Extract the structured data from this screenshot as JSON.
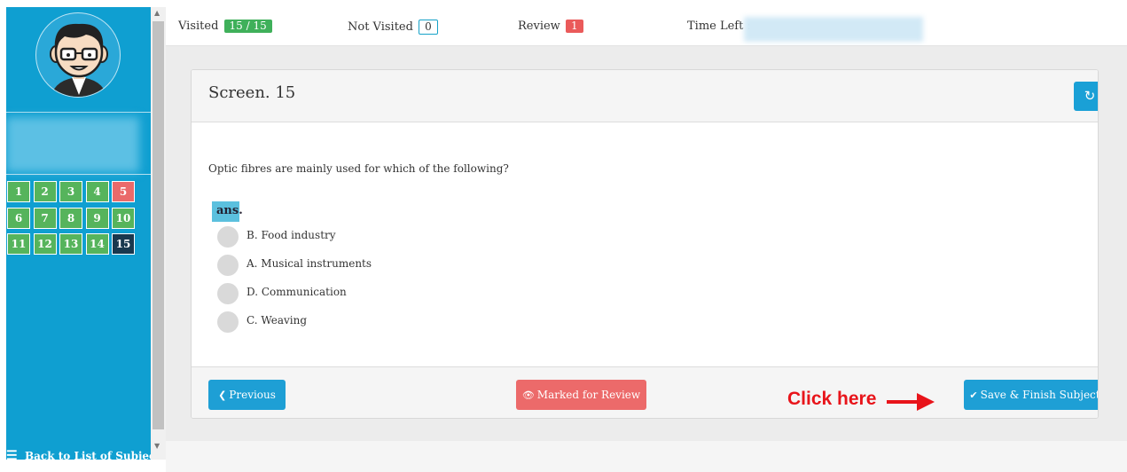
{
  "topbar": {
    "visited_label": "Visited",
    "visited_value": "15 / 15",
    "not_visited_label": "Not Visited",
    "not_visited_value": "0",
    "review_label": "Review",
    "review_value": "1",
    "time_left_label": "Time Left :"
  },
  "sidebar": {
    "back_label": "Back to List of Subjects",
    "back_icon": "bars-icon",
    "questions": [
      {
        "num": "1",
        "status": "answered"
      },
      {
        "num": "2",
        "status": "answered"
      },
      {
        "num": "3",
        "status": "answered"
      },
      {
        "num": "4",
        "status": "answered"
      },
      {
        "num": "5",
        "status": "review"
      },
      {
        "num": "6",
        "status": "answered"
      },
      {
        "num": "7",
        "status": "answered"
      },
      {
        "num": "8",
        "status": "answered"
      },
      {
        "num": "9",
        "status": "answered"
      },
      {
        "num": "10",
        "status": "answered"
      },
      {
        "num": "11",
        "status": "answered"
      },
      {
        "num": "12",
        "status": "answered"
      },
      {
        "num": "13",
        "status": "answered"
      },
      {
        "num": "14",
        "status": "answered"
      },
      {
        "num": "15",
        "status": "current"
      }
    ]
  },
  "panel": {
    "title": "Screen. 15",
    "refresh_icon": "refresh-icon",
    "question": "Optic fibres are mainly used for which of the following?",
    "ans_label": "ans.",
    "options": [
      {
        "text": "B. Food industry"
      },
      {
        "text": "A. Musical instruments"
      },
      {
        "text": "D. Communication"
      },
      {
        "text": "C. Weaving"
      }
    ]
  },
  "footer": {
    "previous_label": "Previous",
    "marked_review_label": "Marked for Review",
    "save_finish_label": "Save & Finish Subject"
  },
  "annotation": {
    "text": "Click here"
  },
  "colors": {
    "sidebar": "#0f9fd1",
    "answered": "#56b45c",
    "review": "#ea6a6a",
    "current": "#19384e",
    "primary_button": "#1e9fd5",
    "annotation": "#e8141a"
  }
}
